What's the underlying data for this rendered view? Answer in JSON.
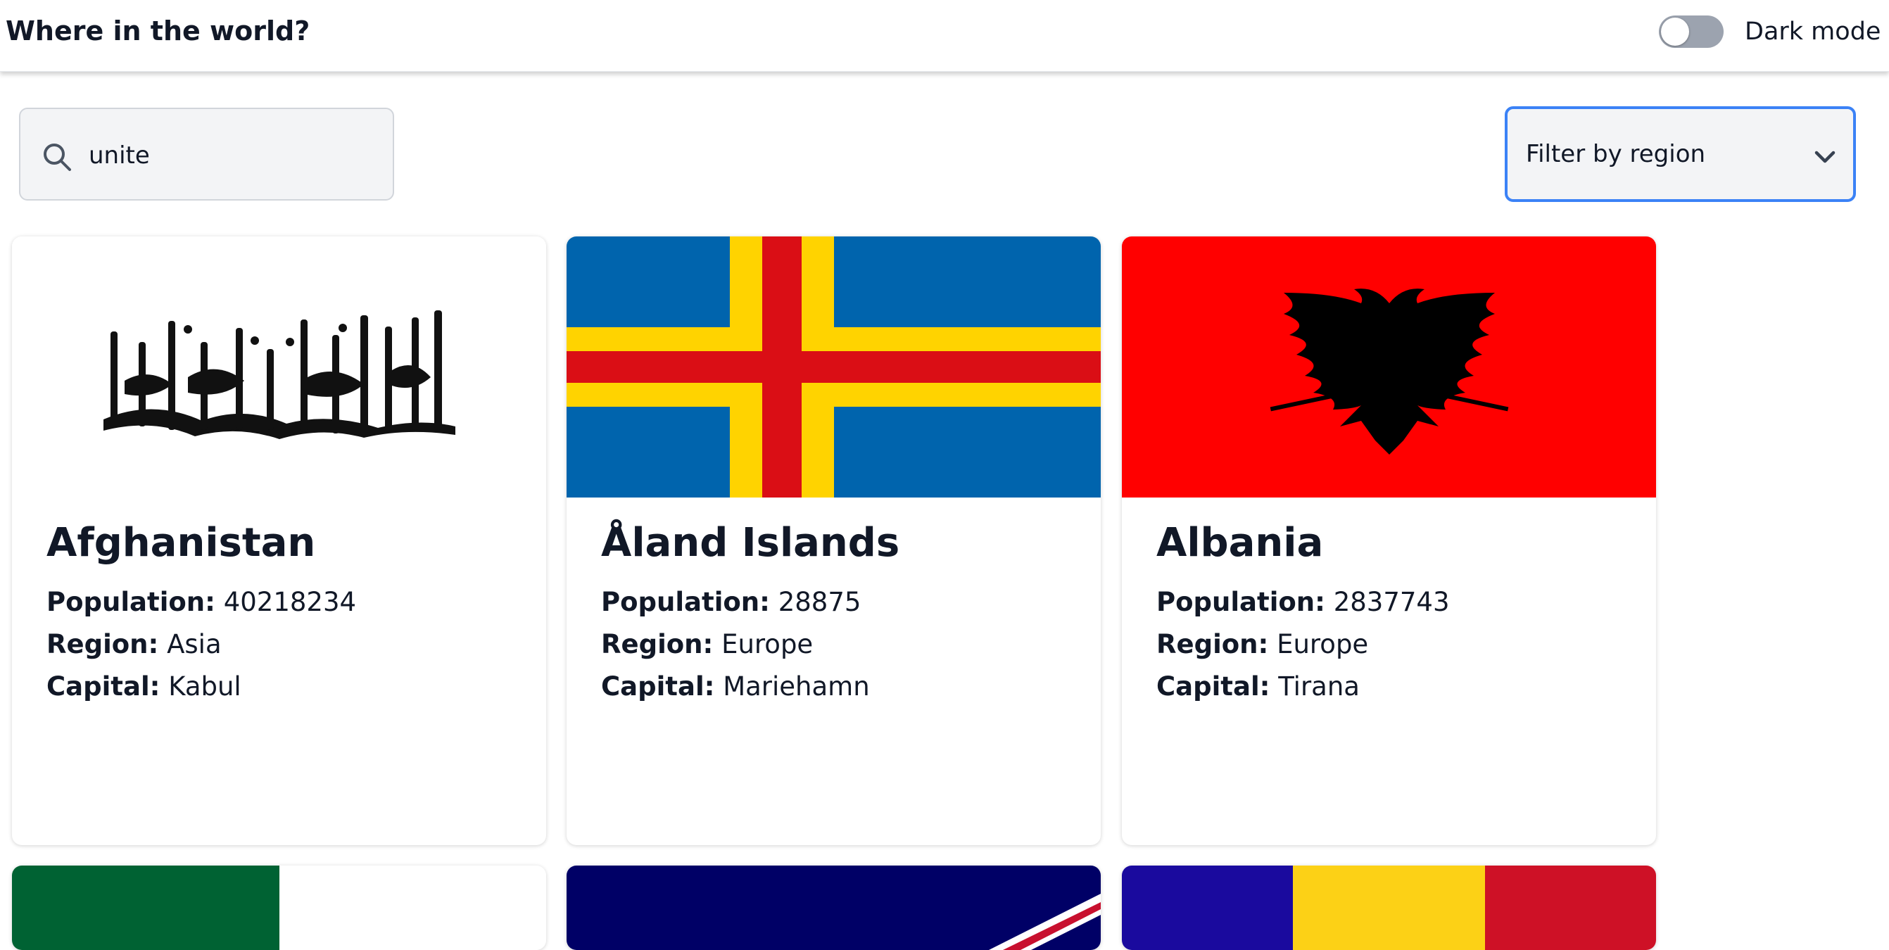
{
  "header": {
    "title": "Where in the world?",
    "dark_mode_label": "Dark mode",
    "dark_mode_on": false
  },
  "search": {
    "value": "unite",
    "icon": "search-icon"
  },
  "filter": {
    "selected": "Filter by region",
    "icon": "chevron-down-icon"
  },
  "countries": [
    {
      "name": "Afghanistan",
      "population_label": "Population:",
      "population": "40218234",
      "region_label": "Region:",
      "region": "Asia",
      "capital_label": "Capital:",
      "capital": "Kabul"
    },
    {
      "name": "Åland Islands",
      "population_label": "Population:",
      "population": "28875",
      "region_label": "Region:",
      "region": "Europe",
      "capital_label": "Capital:",
      "capital": "Mariehamn"
    },
    {
      "name": "Albania",
      "population_label": "Population:",
      "population": "2837743",
      "region_label": "Region:",
      "region": "Europe",
      "capital_label": "Capital:",
      "capital": "Tirana"
    }
  ],
  "colors": {
    "accent": "#3b82f6",
    "text": "#111827",
    "aland_blue": "#0064AD",
    "aland_yellow": "#FFD300",
    "aland_red": "#DA0E15",
    "albania_red": "#FF0000",
    "algeria_green": "#006233",
    "romania_blue": "#1a0a9e",
    "romania_yellow": "#FCD116",
    "romania_red": "#CE1126",
    "navy": "#000066"
  }
}
